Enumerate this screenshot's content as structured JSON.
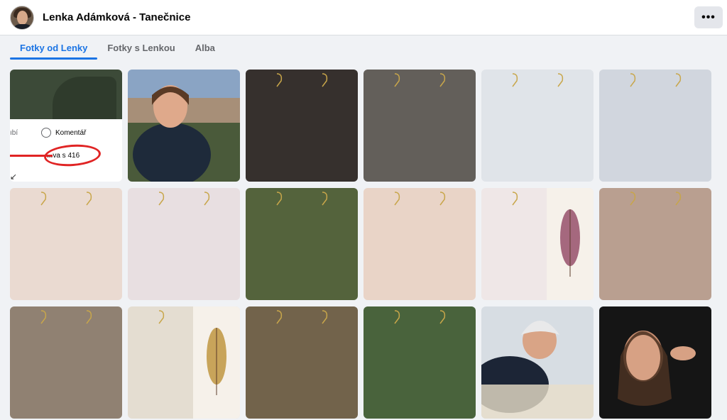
{
  "header": {
    "title": "Lenka Adámková - Tanečnice",
    "more_label": "•••"
  },
  "tabs": [
    {
      "label": "Fotky od Lenky",
      "active": true
    },
    {
      "label": "Fotky s Lenkou",
      "active": false
    },
    {
      "label": "Alba",
      "active": false
    }
  ],
  "first_photo": {
    "like_text": "ıbí",
    "comment_text": "Komentář",
    "share_text": "...va s 416"
  },
  "photos": [
    {
      "kind": "screenshot"
    },
    {
      "kind": "portrait-landscape"
    },
    {
      "kind": "earrings",
      "colors": [
        "#b8a89a",
        "#8fa3a8"
      ],
      "bg": "#2a2420"
    },
    {
      "kind": "earrings",
      "colors": [
        "#f2f2f2",
        "#e8e8e8"
      ],
      "bg": "#5a5550"
    },
    {
      "kind": "earrings",
      "colors": [
        "#7a4a20",
        "#d9b070"
      ],
      "bg": "#dfe3e8"
    },
    {
      "kind": "earrings",
      "colors": [
        "#c2185b",
        "#e8d7e0"
      ],
      "bg": "#cfd4dc"
    },
    {
      "kind": "earrings",
      "colors": [
        "#1a1a1a",
        "#c9a24a"
      ],
      "bg": "#e9d8cf"
    },
    {
      "kind": "earrings",
      "colors": [
        "#1d2b5a",
        "#c9a24a"
      ],
      "bg": "#e7dde0"
    },
    {
      "kind": "earrings",
      "colors": [
        "#d9c6e6",
        "#ffffff"
      ],
      "bg": "#4a5a30"
    },
    {
      "kind": "earrings",
      "colors": [
        "#b07a2a",
        "#3a5a6a"
      ],
      "bg": "#e8d2c4"
    },
    {
      "kind": "earrings-feather",
      "colors": [
        "#8a3a5a",
        "#4a6a5a"
      ],
      "bg": "#efe6e6"
    },
    {
      "kind": "earrings",
      "colors": [
        "#2a4fd6",
        "#c9a24a"
      ],
      "bg": "#b59a8a"
    },
    {
      "kind": "earrings",
      "colors": [
        "#cfe6ee",
        "#b3262e"
      ],
      "bg": "#8a7a6a"
    },
    {
      "kind": "earrings-feather",
      "colors": [
        "#b88a2a",
        "#6a7a4a"
      ],
      "bg": "#e3dbcf"
    },
    {
      "kind": "earrings",
      "colors": [
        "#b3262e",
        "#3a6a3a"
      ],
      "bg": "#6a5a40"
    },
    {
      "kind": "earrings",
      "colors": [
        "#cfe9e6",
        "#e6f4f2"
      ],
      "bg": "#3e5a30"
    },
    {
      "kind": "portrait-hat"
    },
    {
      "kind": "portrait-dark"
    }
  ]
}
